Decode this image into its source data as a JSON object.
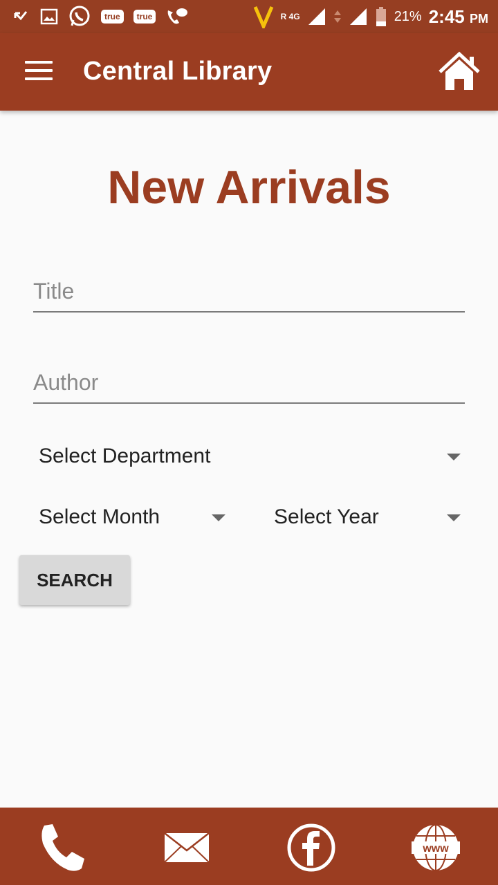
{
  "status_bar": {
    "true_badge_1": "true",
    "true_badge_2": "true",
    "network_label": "R 4G",
    "battery_percent": "21%",
    "time": "2:45",
    "ampm": "PM"
  },
  "app_bar": {
    "title": "Central Library"
  },
  "page": {
    "heading": "New Arrivals"
  },
  "form": {
    "title_placeholder": "Title",
    "author_placeholder": "Author",
    "department": "Select Department",
    "month": "Select Month",
    "year": "Select Year",
    "search_label": "SEARCH"
  },
  "bottom_nav": {
    "phone_icon": "phone-icon",
    "email_icon": "mail-icon",
    "facebook_icon": "facebook-icon",
    "web_icon": "www-icon"
  },
  "colors": {
    "brand": "#9b3d21",
    "status_bar": "#963e22",
    "background": "#fafafa",
    "button": "#d9d9d9"
  }
}
